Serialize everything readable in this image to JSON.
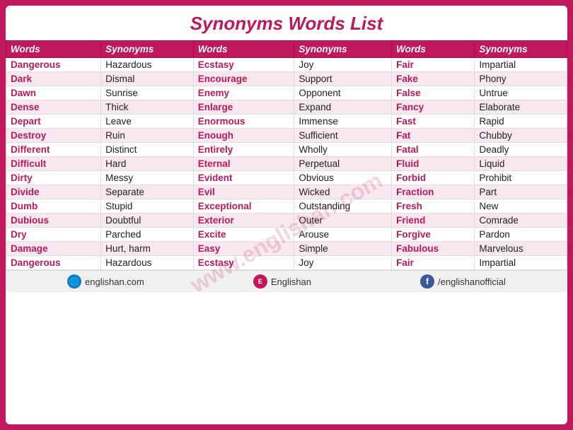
{
  "title": "Synonyms Words List",
  "columns": [
    {
      "header": "Words",
      "type": "words"
    },
    {
      "header": "Synonyms",
      "type": "syn"
    },
    {
      "header": "Words",
      "type": "words"
    },
    {
      "header": "Synonyms",
      "type": "syn"
    },
    {
      "header": "Words",
      "type": "words"
    },
    {
      "header": "Synonyms",
      "type": "syn"
    }
  ],
  "rows": [
    [
      "Dangerous",
      "Hazardous",
      "Ecstasy",
      "Joy",
      "Fair",
      "Impartial"
    ],
    [
      "Dark",
      "Dismal",
      "Encourage",
      "Support",
      "Fake",
      "Phony"
    ],
    [
      "Dawn",
      "Sunrise",
      "Enemy",
      "Opponent",
      "False",
      "Untrue"
    ],
    [
      "Dense",
      "Thick",
      "Enlarge",
      "Expand",
      "Fancy",
      "Elaborate"
    ],
    [
      "Depart",
      "Leave",
      "Enormous",
      "Immense",
      "Fast",
      "Rapid"
    ],
    [
      "Destroy",
      "Ruin",
      "Enough",
      "Sufficient",
      "Fat",
      "Chubby"
    ],
    [
      "Different",
      "Distinct",
      "Entirely",
      "Wholly",
      "Fatal",
      "Deadly"
    ],
    [
      "Difficult",
      "Hard",
      "Eternal",
      "Perpetual",
      "Fluid",
      "Liquid"
    ],
    [
      "Dirty",
      "Messy",
      "Evident",
      "Obvious",
      "Forbid",
      "Prohibit"
    ],
    [
      "Divide",
      "Separate",
      "Evil",
      "Wicked",
      "Fraction",
      "Part"
    ],
    [
      "Dumb",
      "Stupid",
      "Exceptional",
      "Outstanding",
      "Fresh",
      "New"
    ],
    [
      "Dubious",
      "Doubtful",
      "Exterior",
      "Outer",
      "Friend",
      "Comrade"
    ],
    [
      "Dry",
      "Parched",
      "Excite",
      "Arouse",
      "Forgive",
      "Pardon"
    ],
    [
      "Damage",
      "Hurt, harm",
      "Easy",
      "Simple",
      "Fabulous",
      "Marvelous"
    ],
    [
      "Dangerous",
      "Hazardous",
      "Ecstasy",
      "Joy",
      "Fair",
      "Impartial"
    ]
  ],
  "watermark": "www.englishan.com",
  "footer": {
    "items": [
      {
        "icon": "globe",
        "text": "englishan.com"
      },
      {
        "icon": "eng",
        "text": "Englishan"
      },
      {
        "icon": "fb",
        "text": "/englishanofficial"
      }
    ]
  }
}
